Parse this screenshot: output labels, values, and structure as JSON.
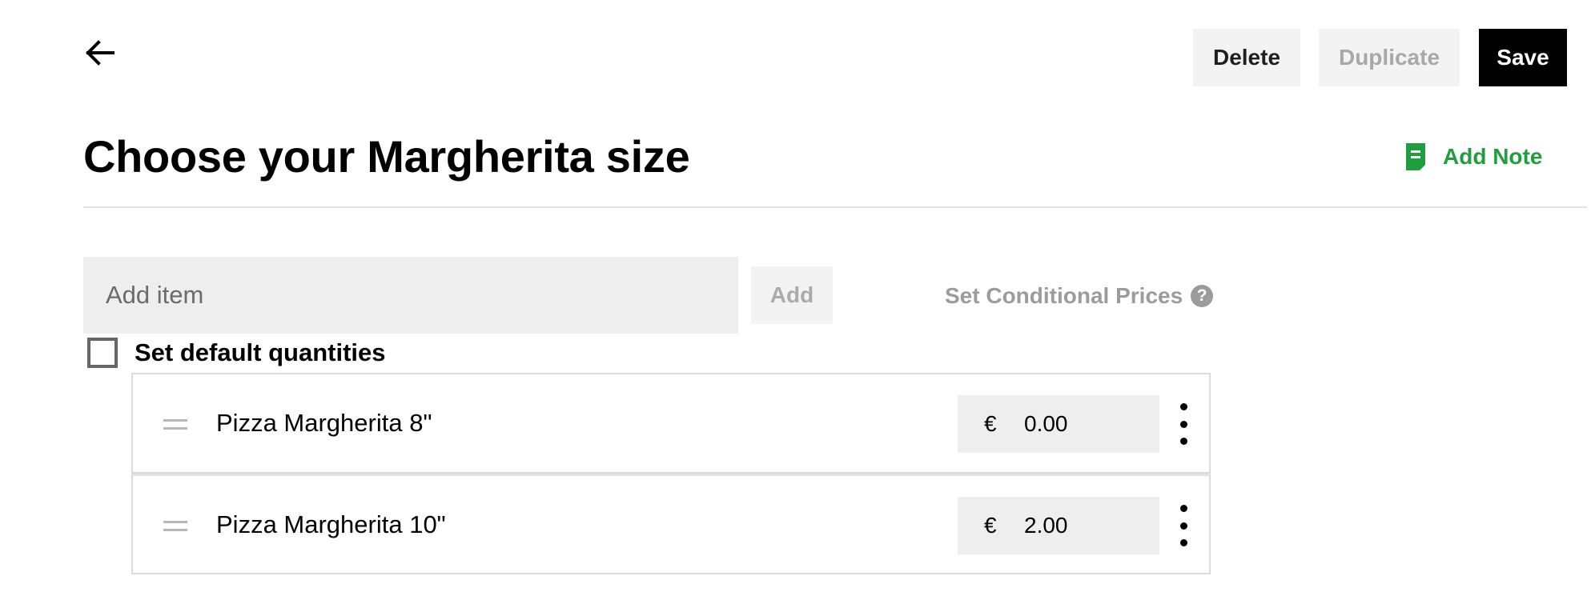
{
  "header": {
    "back_icon": "arrow-left-icon",
    "delete_label": "Delete",
    "duplicate_label": "Duplicate",
    "save_label": "Save"
  },
  "title": "Choose your Margherita size",
  "add_note": {
    "icon": "note-icon",
    "label": "Add Note",
    "color": "#1f9e3e"
  },
  "add_item": {
    "placeholder": "Add item",
    "value": "",
    "button_label": "Add"
  },
  "conditional_prices": {
    "label": "Set Conditional Prices",
    "help_icon": "?"
  },
  "default_quantities": {
    "label": "Set default quantities",
    "checked": false
  },
  "items": [
    {
      "name": "Pizza Margherita 8\"",
      "currency": "€",
      "price": "0.00"
    },
    {
      "name": "Pizza Margherita 10\"",
      "currency": "€",
      "price": "2.00"
    }
  ]
}
